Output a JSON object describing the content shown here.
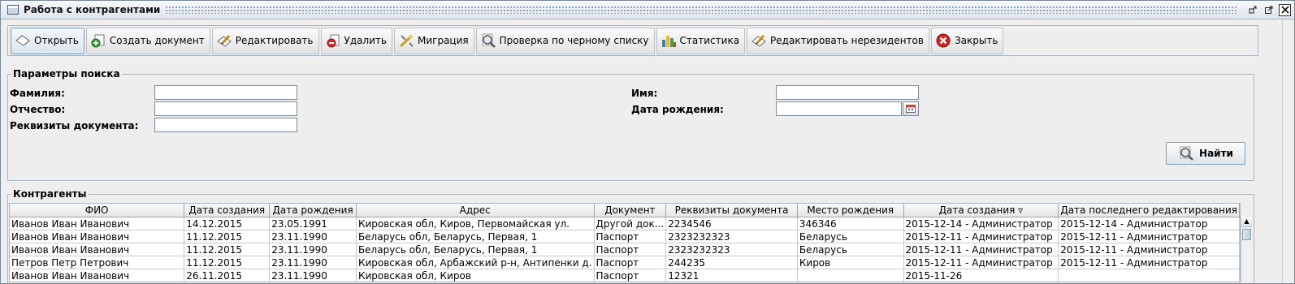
{
  "window": {
    "title": "Работа с контрагентами"
  },
  "toolbar": {
    "buttons": [
      {
        "label": "Открыть",
        "icon": "open-icon"
      },
      {
        "label": "Создать документ",
        "icon": "create-icon"
      },
      {
        "label": "Редактировать",
        "icon": "edit-icon"
      },
      {
        "label": "Удалить",
        "icon": "delete-icon"
      },
      {
        "label": "Миграция",
        "icon": "migration-icon"
      },
      {
        "label": "Проверка по черному списку",
        "icon": "magnifier-icon"
      },
      {
        "label": "Статистика",
        "icon": "bar-chart-icon"
      },
      {
        "label": "Редактировать нерезидентов",
        "icon": "edit-icon"
      },
      {
        "label": "Закрыть",
        "icon": "close-icon"
      }
    ]
  },
  "search": {
    "legend": "Параметры поиска",
    "last_name_label": "Фамилия:",
    "last_name_value": "",
    "patronymic_label": "Отчество:",
    "patronymic_value": "",
    "doc_details_label": "Реквизиты документа:",
    "doc_details_value": "",
    "first_name_label": "Имя:",
    "first_name_value": "",
    "birth_date_label": "Дата рождения:",
    "birth_date_value": "",
    "find_label": "Найти"
  },
  "contractors": {
    "legend": "Контрагенты",
    "columns": [
      "ФИО",
      "Дата создания",
      "Дата рождения",
      "Адрес",
      "Документ",
      "Реквизиты документа",
      "Место рождения",
      "Дата создания ▿",
      "Дата последнего редактирования"
    ],
    "rows": [
      [
        "Иванов Иван Иванович",
        "14.12.2015",
        "23.05.1991",
        "Кировская обл, Киров, Первомайская ул.",
        "Другой док...",
        "2234546",
        "346346",
        "2015-12-14 - Администратор",
        "2015-12-14 - Администратор"
      ],
      [
        "Иванов Иван Иванович",
        "11.12.2015",
        "23.11.1990",
        "Беларусь обл, Беларусь, Первая, 1",
        "Паспорт",
        "2323232323",
        "Беларусь",
        "2015-12-11 - Администратор",
        "2015-12-11 - Администратор"
      ],
      [
        "Иванов Иван Иванович",
        "11.12.2015",
        "23.11.1990",
        "Беларусь обл, Беларусь, Первая, 1",
        "Паспорт",
        "2323232323",
        "Беларусь",
        "2015-12-11 - Администратор",
        "2015-12-11 - Администратор"
      ],
      [
        "Петров Петр Петрович",
        "11.12.2015",
        "23.11.1990",
        "Кировская обл, Арбажский р-н, Антипенки д.",
        "Паспорт",
        "244235",
        "Киров",
        "2015-12-11 - Администратор",
        "2015-12-11 - Администратор"
      ],
      [
        "Иванов Иван Иванович",
        "26.11.2015",
        "23.11.1990",
        "Кировская обл, Киров",
        "Паспорт",
        "12321",
        "",
        "2015-11-26",
        ""
      ]
    ]
  }
}
